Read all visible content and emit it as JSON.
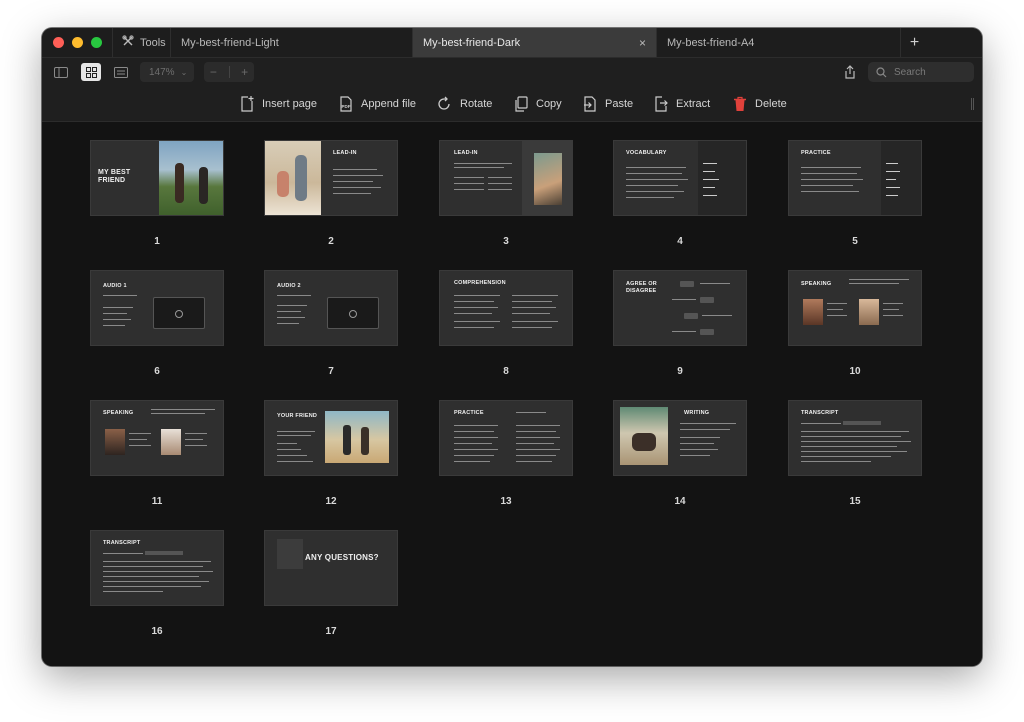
{
  "window": {
    "tools_label": "Tools",
    "tabs": [
      {
        "label": "My-best-friend-Light",
        "active": false
      },
      {
        "label": "My-best-friend-Dark",
        "active": true
      },
      {
        "label": "My-best-friend-A4",
        "active": false
      }
    ],
    "close_glyph": "×",
    "new_tab_glyph": "+"
  },
  "toolbar": {
    "zoom": "147%",
    "zoom_out": "−",
    "zoom_in": "+",
    "search_placeholder": "Search"
  },
  "actions": {
    "insert_page": "Insert page",
    "append_file": "Append file",
    "rotate": "Rotate",
    "copy": "Copy",
    "paste": "Paste",
    "extract": "Extract",
    "delete": "Delete"
  },
  "pages": [
    {
      "number": "1",
      "title": "MY BEST FRIEND"
    },
    {
      "number": "2",
      "title": "LEAD-IN"
    },
    {
      "number": "3",
      "title": "LEAD-IN"
    },
    {
      "number": "4",
      "title": "VOCABULARY"
    },
    {
      "number": "5",
      "title": "PRACTICE"
    },
    {
      "number": "6",
      "title": "AUDIO 1"
    },
    {
      "number": "7",
      "title": "AUDIO 2"
    },
    {
      "number": "8",
      "title": "COMPREHENSION"
    },
    {
      "number": "9",
      "title": "AGREE OR DISAGREE"
    },
    {
      "number": "10",
      "title": "SPEAKING"
    },
    {
      "number": "11",
      "title": "SPEAKING"
    },
    {
      "number": "12",
      "title": "YOUR FRIEND"
    },
    {
      "number": "13",
      "title": "PRACTICE"
    },
    {
      "number": "14",
      "title": "WRITING"
    },
    {
      "number": "15",
      "title": "TRANSCRIPT"
    },
    {
      "number": "16",
      "title": "TRANSCRIPT"
    },
    {
      "number": "17",
      "title": "ANY QUESTIONS?"
    }
  ],
  "colors": {
    "close": "#ff5f57",
    "minimize": "#febc2e",
    "zoom": "#28c840",
    "delete": "#e0413b",
    "background": "#131313",
    "thumb": "#2f2f2f"
  }
}
